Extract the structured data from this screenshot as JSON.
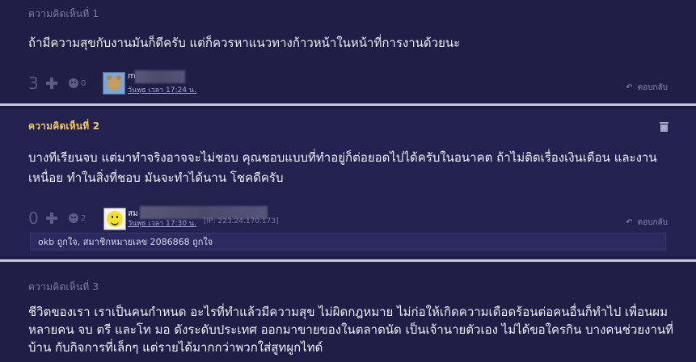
{
  "comments": [
    {
      "title": "ความคิดเห็นที่ 1",
      "text": "ถ้ามีความสุขกับงานมันก็ดีครับ  แต่ก็ควรหาแนวทางก้าวหน้าในหน้าที่การงานด้วยนะ",
      "score": "3",
      "emo_count": "0",
      "username": "m",
      "time": "วันพุธ เวลา 17:24 น.",
      "reply_label": "ตอบกลับ"
    },
    {
      "title": "ความคิดเห็นที่ 2",
      "text": "บางทีเรียนจบ แต่มาทำจริงอาจจะไม่ชอบ คุณชอบแบบที่ทำอยู่ก็ต่อยอดไปได้ครับในอนาคต  ถ้าไม่ติดเรื่องเงินเดือน และงานเหนื่อย ทำในสิ่งที่ชอบ มันจะทำได้นาน โชคดีครับ",
      "score": "0",
      "emo_count": "2",
      "username": "สม",
      "time": "วันพุธ เวลา 17:30 น.",
      "ip": "[IP: 223.24.170.173]",
      "reply_label": "ตอบกลับ",
      "likes": "okb ถูกใจ, สมาชิกหมายเลข 2086868 ถูกใจ"
    },
    {
      "title": "ความคิดเห็นที่ 3",
      "text": "ชีวิตของเรา เราเป็นคนกำหนด อะไรที่ทำแล้วมีความสุข  ไม่ผิดกฎหมาย ไม่ก่อให้เกิดความเดือดร้อนต่อคนอื่นก็ทำไป เพื่อนผมหลายคน จบ ตรี และโท มอ ดังระดับประเทศ ออกมาขายของในตลาดนัด เป็นเจ้านายตัวเอง ไม่ได้ขอใครกิน บางคนช่วยงานที่บ้าน กับกิจการที่เล็กๆ แต่รายได้มากกว่าพวกใส่สูทผูกไทด์"
    }
  ],
  "icons": {
    "vote": "plus-icon",
    "emotion": "emotion-icon",
    "reply": "reply-arrow-icon",
    "delete": "trash-icon"
  },
  "colors": {
    "background": "#1f1d45",
    "highlight_title": "#f2c86a",
    "separator": "#c8c8d8"
  }
}
